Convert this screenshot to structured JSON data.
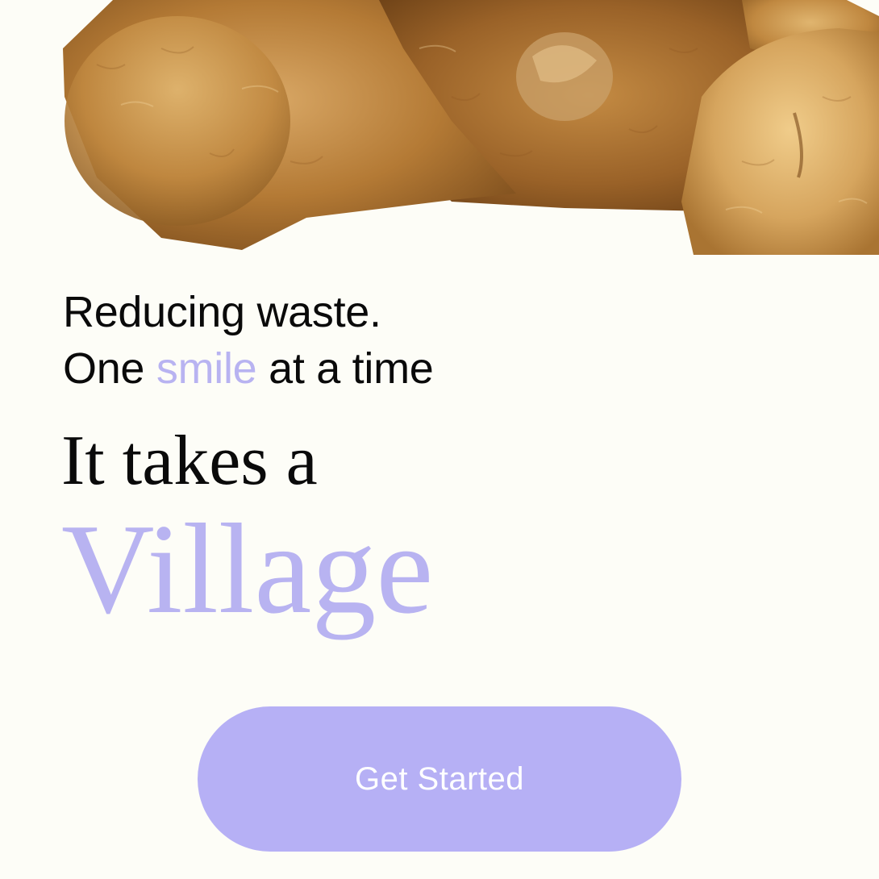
{
  "hero": {
    "image": "teddy-bear-photo"
  },
  "tagline": {
    "line1": "Reducing waste.",
    "line2_prefix": "One ",
    "line2_accent": "smile",
    "line2_suffix": " at a time"
  },
  "headline": {
    "prefix": "It takes a",
    "highlight": "Village"
  },
  "cta": {
    "label": "Get Started"
  },
  "colors": {
    "background": "#fdfdf7",
    "accent": "#b8b3f1",
    "button": "#b6b0f5",
    "text": "#0a0a0a"
  }
}
